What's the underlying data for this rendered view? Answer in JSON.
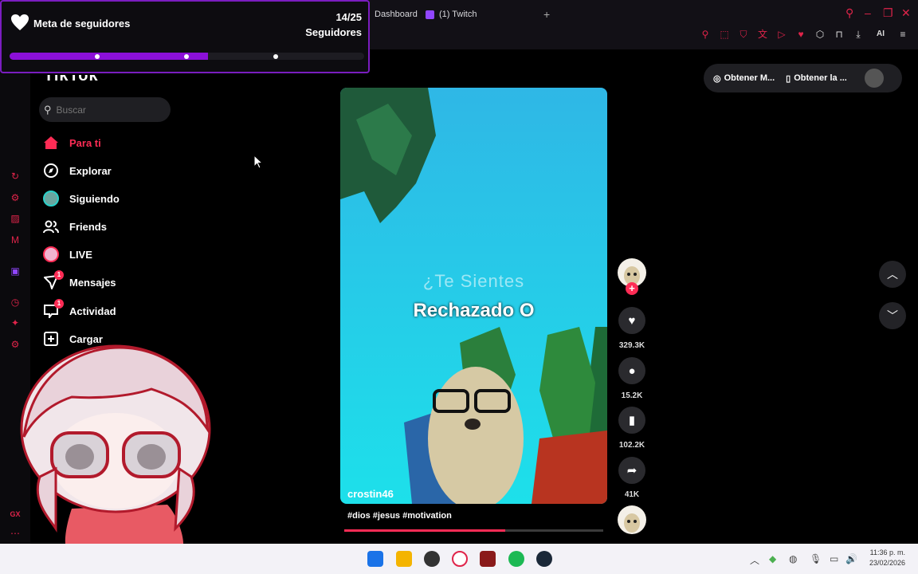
{
  "browser": {
    "tabs": [
      {
        "label": "Dashboard"
      },
      {
        "label": "(1) Twitch"
      }
    ],
    "new_tab": "+",
    "toolbar_ai": "AI"
  },
  "widget": {
    "title": "Meta de seguidores",
    "count": "14/25",
    "count_label": "Seguidores",
    "progress": 0.56
  },
  "tiktok": {
    "logo": "TikTok",
    "search_placeholder": "Buscar",
    "nav": [
      {
        "label": "Para ti",
        "icon": "home-icon",
        "active": true
      },
      {
        "label": "Explorar",
        "icon": "compass-icon"
      },
      {
        "label": "Siguiendo",
        "icon": "following-avatar-icon"
      },
      {
        "label": "Friends",
        "icon": "friends-icon"
      },
      {
        "label": "LIVE",
        "icon": "live-icon"
      },
      {
        "label": "Mensajes",
        "icon": "messages-icon",
        "badge": "1"
      },
      {
        "label": "Actividad",
        "icon": "activity-icon",
        "badge": "1"
      },
      {
        "label": "Cargar",
        "icon": "upload-icon"
      }
    ],
    "top_actions": {
      "get_coins": "Obtener M...",
      "get_app": "Obtener la ..."
    },
    "video": {
      "caption_line1": "¿Te Sientes",
      "caption_line2": "Rechazado O",
      "username": "crostin46",
      "hashtags": "#dios #jesus #motivation",
      "progress": 0.62
    },
    "actions": {
      "likes": "329.3K",
      "comments": "15.2K",
      "saves": "102.2K",
      "shares": "41K"
    }
  },
  "opera_side": {
    "bottom_label": "GX"
  },
  "taskbar": {
    "time": "11:36 p. m.",
    "date": "23/02/2026"
  },
  "colors": {
    "accent": "#fe2c55",
    "widget_border": "#7a1dbf",
    "widget_fill": "#8b10d8",
    "opera_red": "#e0244a"
  }
}
